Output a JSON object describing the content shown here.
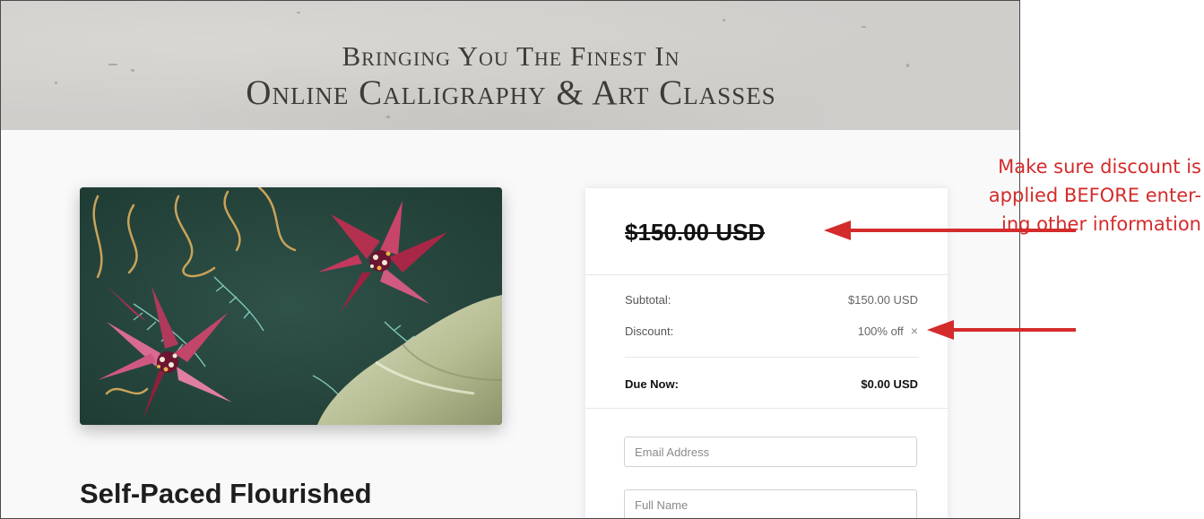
{
  "banner": {
    "line1": "Bringing You The Finest In",
    "line2": "Online Calligraphy & Art Classes"
  },
  "product": {
    "title": "Self-Paced Flourished"
  },
  "checkout": {
    "price": "$150.00 USD",
    "subtotal_label": "Subtotal:",
    "subtotal_value": "$150.00 USD",
    "discount_label": "Discount:",
    "discount_value": "100% off",
    "discount_remove": "×",
    "due_label": "Due Now:",
    "due_value": "$0.00 USD",
    "email_placeholder": "Email Address",
    "fullname_placeholder": "Full Name"
  },
  "annotation": {
    "lines": [
      "Make sure discount is",
      "applied BEFORE enter-",
      "ing other information"
    ],
    "color": "#d42b2b"
  }
}
